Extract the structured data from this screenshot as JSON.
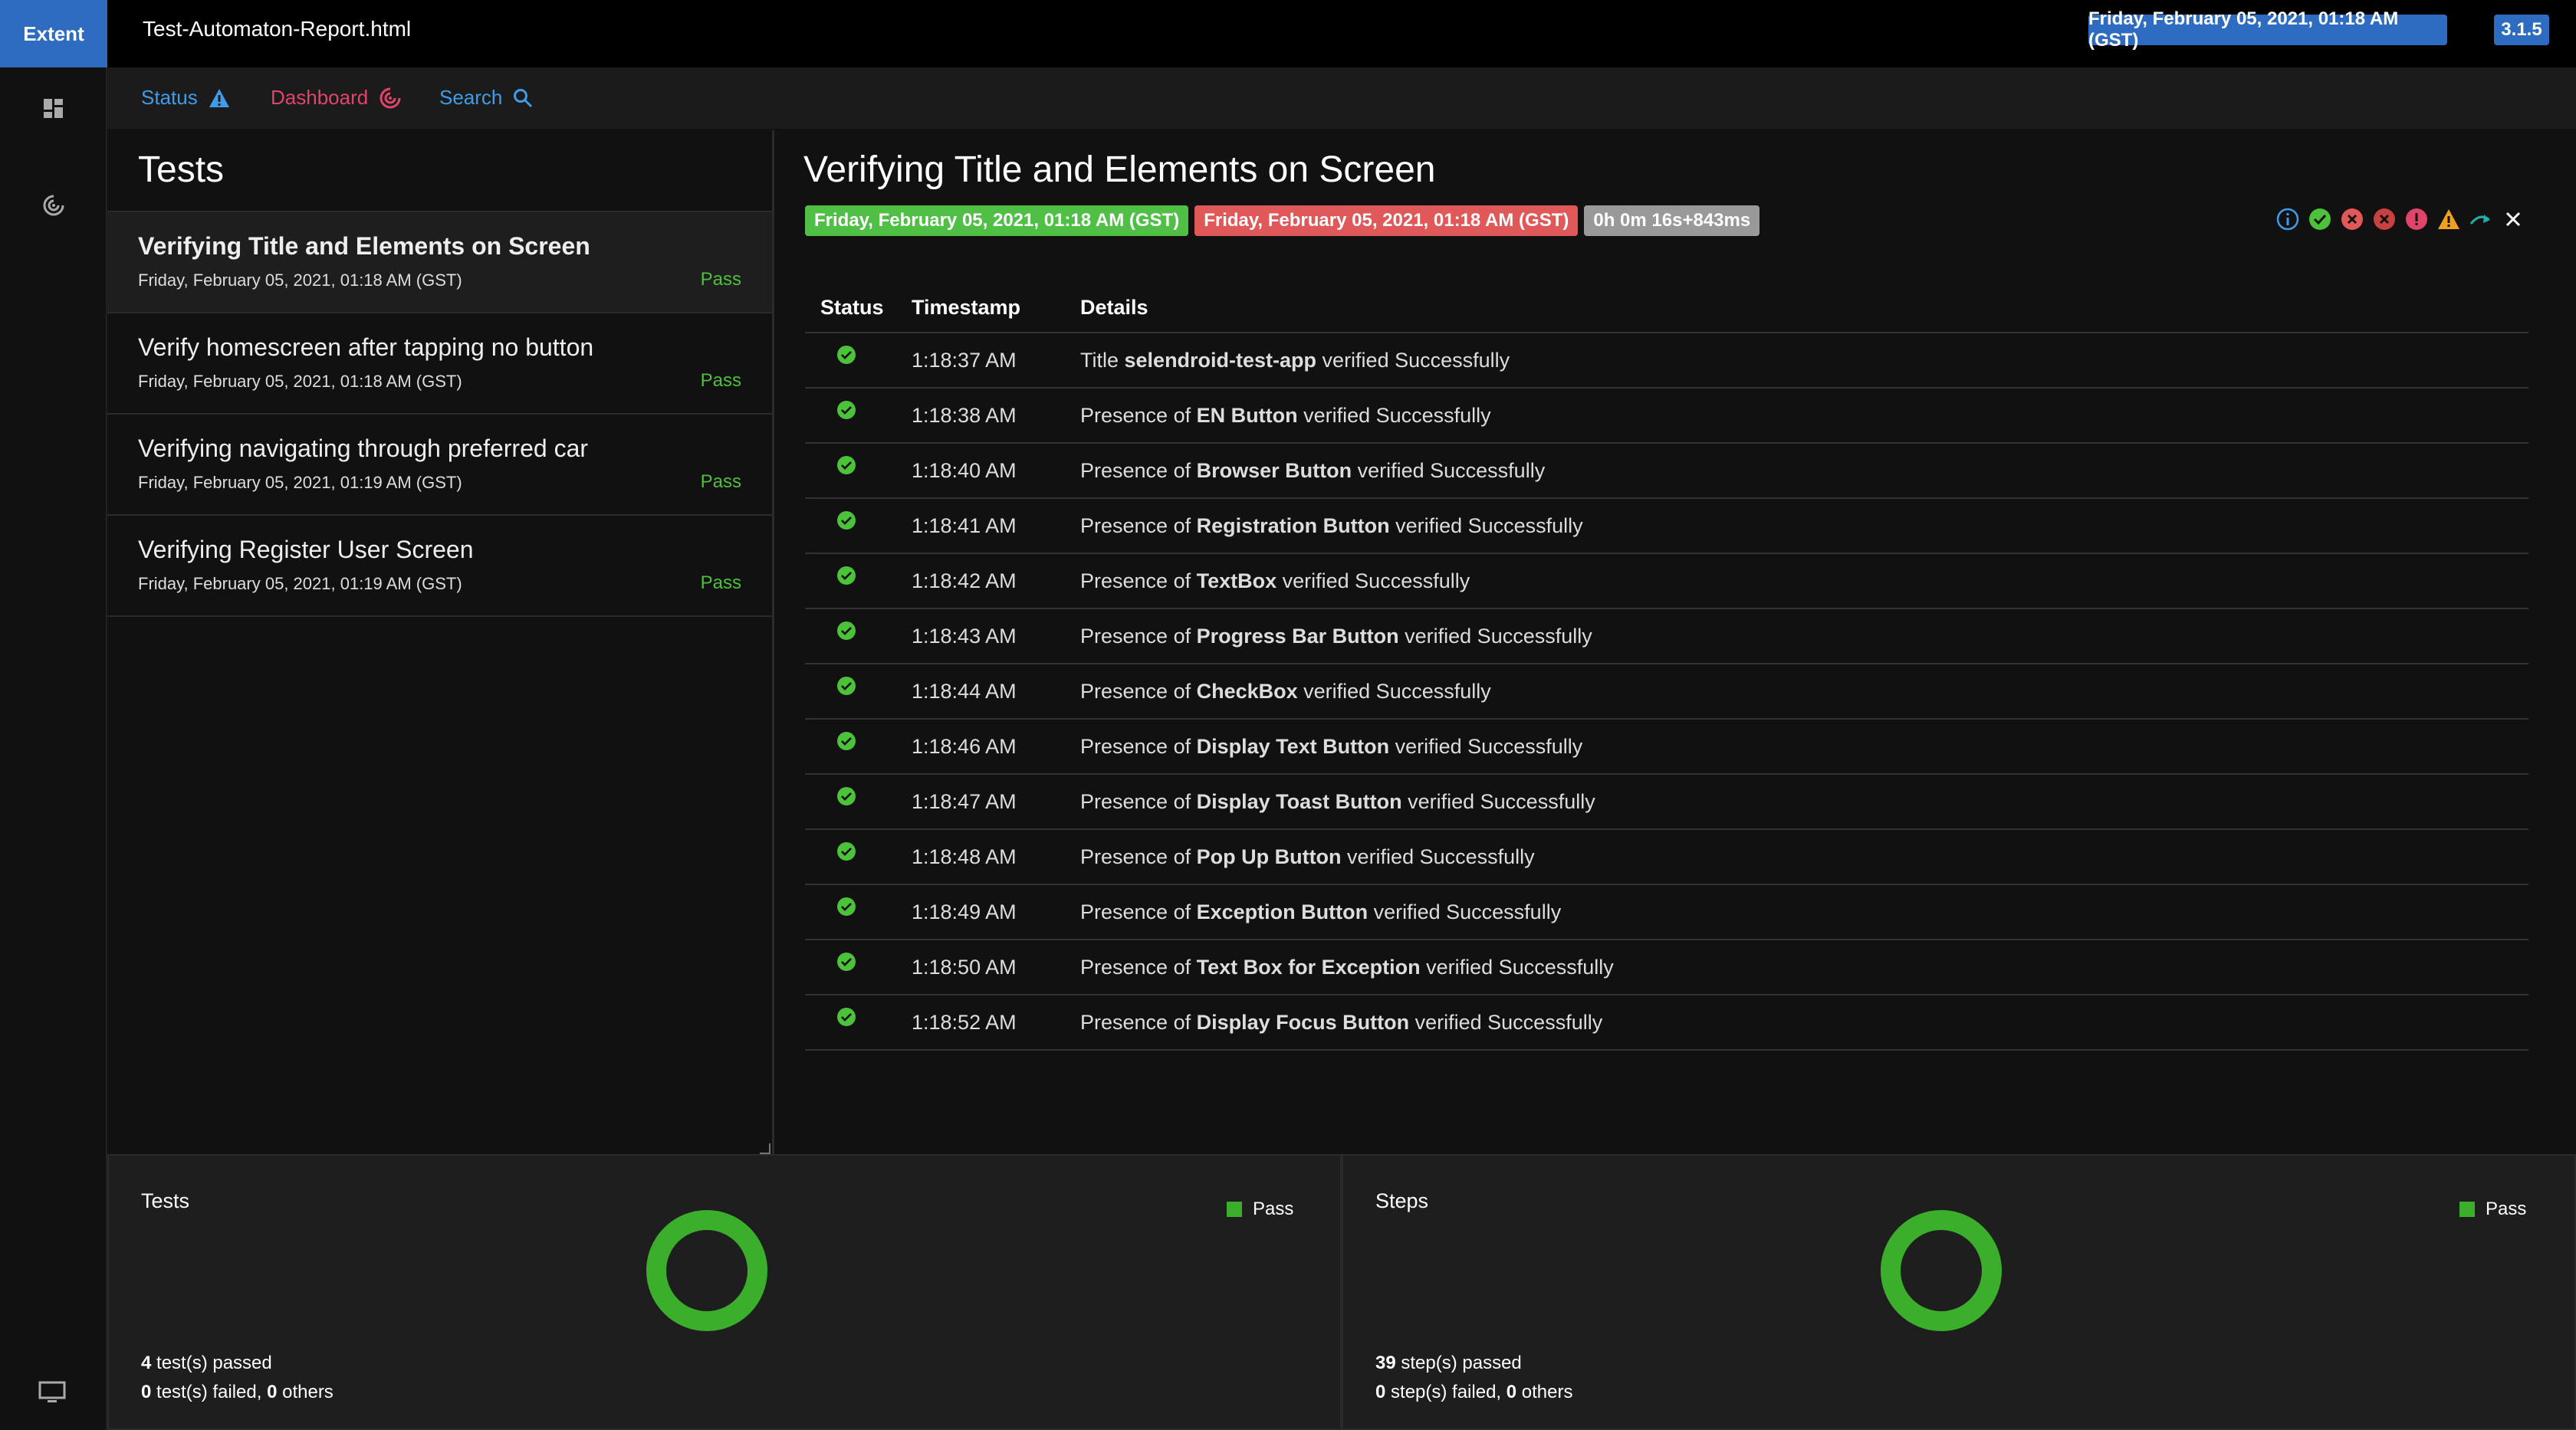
{
  "app": {
    "brand": "Extent",
    "report_name": "Test-Automaton-Report.html",
    "report_date": "Friday, February 05, 2021, 01:18 AM (GST)",
    "version": "3.1.5"
  },
  "sidebar": {
    "icons": [
      "dashboard-icon",
      "target-icon",
      "monitor-icon"
    ]
  },
  "subnav": {
    "status_label": "Status",
    "dashboard_label": "Dashboard",
    "search_label": "Search"
  },
  "tests_panel": {
    "title": "Tests",
    "items": [
      {
        "name": "Verifying Title and Elements on Screen",
        "time": "Friday, February 05, 2021, 01:18 AM (GST)",
        "status": "Pass"
      },
      {
        "name": "Verify homescreen after tapping no button",
        "time": "Friday, February 05, 2021, 01:18 AM (GST)",
        "status": "Pass"
      },
      {
        "name": "Verifying navigating through preferred car",
        "time": "Friday, February 05, 2021, 01:19 AM (GST)",
        "status": "Pass"
      },
      {
        "name": "Verifying Register User Screen",
        "time": "Friday, February 05, 2021, 01:19 AM (GST)",
        "status": "Pass"
      }
    ]
  },
  "detail": {
    "title": "Verifying Title and Elements on Screen",
    "start": "Friday, February 05, 2021, 01:18 AM (GST)",
    "end": "Friday, February 05, 2021, 01:18 AM (GST)",
    "duration": "0h 0m 16s+843ms",
    "filters": [
      "info-icon",
      "pass-icon",
      "fail-icon",
      "fatal-icon",
      "error-icon",
      "warning-icon",
      "skip-icon",
      "clear-icon"
    ],
    "columns": {
      "status": "Status",
      "timestamp": "Timestamp",
      "details": "Details"
    },
    "steps": [
      {
        "time": "1:18:37 AM",
        "pre": "Title ",
        "bold": "selendroid-test-app",
        "post": " verified Successfully"
      },
      {
        "time": "1:18:38 AM",
        "pre": "Presence of ",
        "bold": "EN Button",
        "post": " verified Successfully"
      },
      {
        "time": "1:18:40 AM",
        "pre": "Presence of ",
        "bold": "Browser Button",
        "post": " verified Successfully"
      },
      {
        "time": "1:18:41 AM",
        "pre": "Presence of ",
        "bold": "Registration Button",
        "post": " verified Successfully"
      },
      {
        "time": "1:18:42 AM",
        "pre": "Presence of ",
        "bold": "TextBox",
        "post": " verified Successfully"
      },
      {
        "time": "1:18:43 AM",
        "pre": "Presence of ",
        "bold": "Progress Bar Button",
        "post": " verified Successfully"
      },
      {
        "time": "1:18:44 AM",
        "pre": "Presence of ",
        "bold": "CheckBox",
        "post": " verified Successfully"
      },
      {
        "time": "1:18:46 AM",
        "pre": "Presence of ",
        "bold": "Display Text Button",
        "post": " verified Successfully"
      },
      {
        "time": "1:18:47 AM",
        "pre": "Presence of ",
        "bold": "Display Toast Button",
        "post": " verified Successfully"
      },
      {
        "time": "1:18:48 AM",
        "pre": "Presence of ",
        "bold": "Pop Up Button",
        "post": " verified Successfully"
      },
      {
        "time": "1:18:49 AM",
        "pre": "Presence of ",
        "bold": "Exception Button",
        "post": " verified Successfully"
      },
      {
        "time": "1:18:50 AM",
        "pre": "Presence of ",
        "bold": "Text Box for Exception",
        "post": " verified Successfully"
      },
      {
        "time": "1:18:52 AM",
        "pre": "Presence of ",
        "bold": "Display Focus Button",
        "post": " verified Successfully"
      }
    ]
  },
  "summary": {
    "tests": {
      "title": "Tests",
      "legend": "Pass",
      "passed": "4",
      "passed_text": " test(s) passed",
      "failed": "0",
      "failed_text": " test(s) failed, ",
      "others": "0",
      "others_text": " others"
    },
    "steps": {
      "title": "Steps",
      "legend": "Pass",
      "passed": "39",
      "passed_text": " step(s) passed",
      "failed": "0",
      "failed_text": " step(s) failed, ",
      "others": "0",
      "others_text": " others"
    }
  },
  "colors": {
    "accent": "#2d6cc0",
    "pass": "#4cc13a",
    "fail": "#e05858",
    "dashboard": "#e0446a"
  }
}
